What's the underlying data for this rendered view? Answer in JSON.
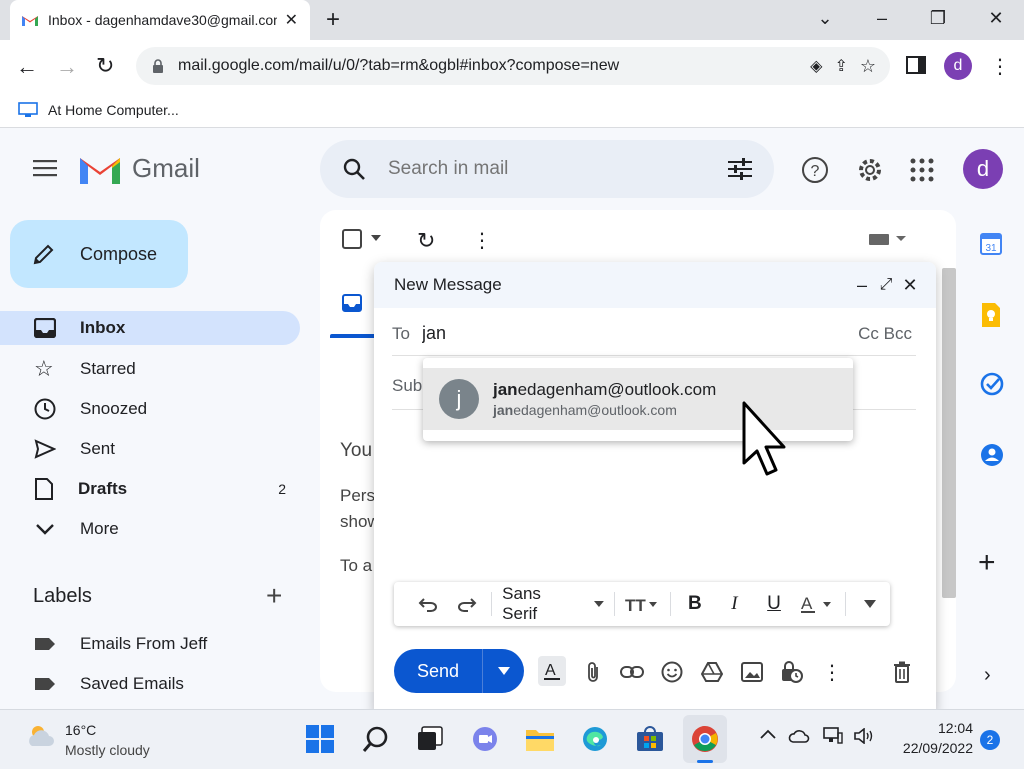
{
  "browser": {
    "tab_title": "Inbox - dagenhamdave30@gmail.com",
    "url": "mail.google.com/mail/u/0/?tab=rm&ogbl#inbox?compose=new",
    "profile_letter": "d",
    "bookmark": "At Home Computer..."
  },
  "gmail": {
    "logo_text": "Gmail",
    "search_placeholder": "Search in mail",
    "profile_letter": "d",
    "compose_label": "Compose",
    "nav": [
      {
        "label": "Inbox",
        "count": ""
      },
      {
        "label": "Starred",
        "count": ""
      },
      {
        "label": "Snoozed",
        "count": ""
      },
      {
        "label": "Sent",
        "count": ""
      },
      {
        "label": "Drafts",
        "count": "2"
      },
      {
        "label": "More",
        "count": ""
      }
    ],
    "labels_title": "Labels",
    "labels": [
      "Emails From Jeff",
      "Saved Emails"
    ],
    "behind_text": {
      "line1": "You",
      "line2a": "Pers",
      "line2b": "show",
      "line3": "To a"
    }
  },
  "compose": {
    "title": "New Message",
    "to_label": "To",
    "to_value": "jan",
    "cc_bcc": "Cc Bcc",
    "subject_placeholder": "Sub",
    "suggestion": {
      "avatar": "j",
      "name_bold": "jan",
      "name_rest": "edagenham@outlook.com",
      "email_bold": "jan",
      "email_rest": "edagenham@outlook.com"
    },
    "font_name": "Sans Serif",
    "send_label": "Send"
  },
  "taskbar": {
    "temp": "16°C",
    "weather": "Mostly cloudy",
    "time": "12:04",
    "date": "22/09/2022",
    "notifications": "2"
  },
  "colors": {
    "compose_bg": "#c2e7ff",
    "nav_active": "#d3e3fd",
    "send_blue": "#0b57d0",
    "avatar_purple": "#7b3fb3"
  }
}
